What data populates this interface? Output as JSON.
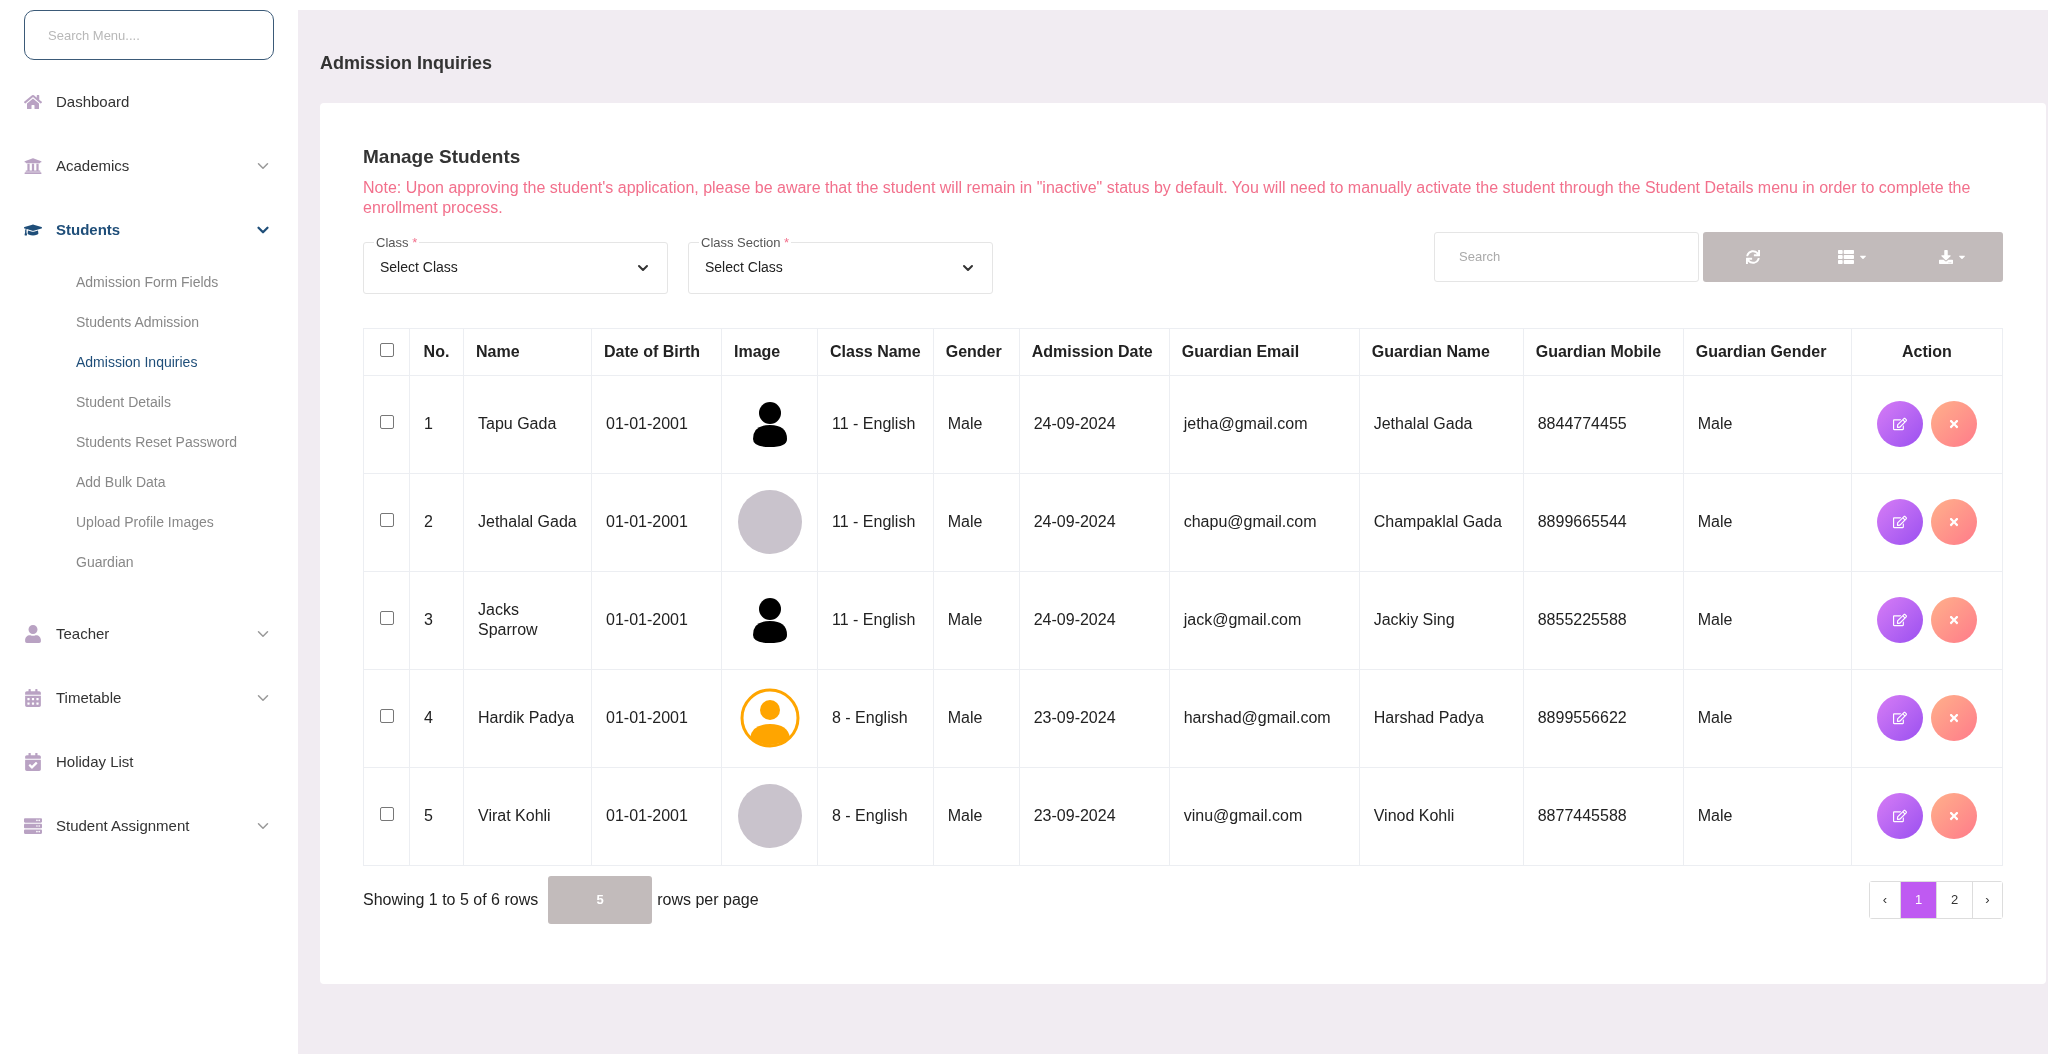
{
  "sidebar": {
    "search": {
      "placeholder": "Search Menu...."
    },
    "items": [
      {
        "label": "Dashboard",
        "selected": false
      },
      {
        "label": "Academics",
        "selected": false,
        "expanded": false
      },
      {
        "label": "Students",
        "selected": true,
        "expanded": true,
        "children": [
          {
            "label": "Admission Form Fields",
            "selected": false
          },
          {
            "label": "Students Admission",
            "selected": false
          },
          {
            "label": "Admission Inquiries",
            "selected": true
          },
          {
            "label": "Student Details",
            "selected": false
          },
          {
            "label": "Students Reset Password",
            "selected": false
          },
          {
            "label": "Add Bulk Data",
            "selected": false
          },
          {
            "label": "Upload Profile Images",
            "selected": false
          },
          {
            "label": "Guardian",
            "selected": false
          }
        ]
      },
      {
        "label": "Teacher",
        "selected": false,
        "expanded": false
      },
      {
        "label": "Timetable",
        "selected": false,
        "expanded": false
      },
      {
        "label": "Holiday List",
        "selected": false
      },
      {
        "label": "Student Assignment",
        "selected": false,
        "expanded": false
      }
    ]
  },
  "page_title": "Admission Inquiries",
  "card": {
    "title": "Manage Students",
    "note": "Note: Upon approving the student's application, please be aware that the student will remain in \"inactive\" status by default. You will need to manually activate the student through the Student Details menu in order to complete the enrollment process.",
    "filters": [
      {
        "label": "Class",
        "required_mark": "*",
        "value": "Select Class"
      },
      {
        "label": "Class Section",
        "required_mark": "*",
        "value": "Select Class"
      }
    ],
    "search": {
      "placeholder": "Search"
    },
    "table": {
      "header_checked": false,
      "columns": [
        "No.",
        "Name",
        "Date of Birth",
        "Image",
        "Class Name",
        "Gender",
        "Admission Date",
        "Guardian Email",
        "Guardian Name",
        "Guardian Mobile",
        "Guardian Gender",
        "Action"
      ],
      "rows": [
        {
          "checked": false,
          "no": "1",
          "name": "Tapu Gada",
          "dob": "01-01-2001",
          "kind": "person-icon",
          "class": "11 - English",
          "gender": "Male",
          "admission_date": "24-09-2024",
          "guardian_email": "jetha@gmail.com",
          "guardian_name": "Jethalal Gada",
          "guardian_mobile": "8844774455",
          "guardian_gender": "Male"
        },
        {
          "checked": false,
          "no": "2",
          "name": "Jethalal Gada",
          "dob": "01-01-2001",
          "kind": "photo",
          "class": "11 - English",
          "gender": "Male",
          "admission_date": "24-09-2024",
          "guardian_email": "chapu@gmail.com",
          "guardian_name": "Champaklal Gada",
          "guardian_mobile": "8899665544",
          "guardian_gender": "Male"
        },
        {
          "checked": false,
          "no": "3",
          "name": "Jacks Sparrow",
          "dob": "01-01-2001",
          "kind": "person-icon",
          "class": "11 - English",
          "gender": "Male",
          "admission_date": "24-09-2024",
          "guardian_email": "jack@gmail.com",
          "guardian_name": "Jackiy Sing",
          "guardian_mobile": "8855225588",
          "guardian_gender": "Male"
        },
        {
          "checked": false,
          "no": "4",
          "name": "Hardik Padya",
          "dob": "01-01-2001",
          "kind": "ring-icon",
          "class": "8 - English",
          "gender": "Male",
          "admission_date": "23-09-2024",
          "guardian_email": "harshad@gmail.com",
          "guardian_name": "Harshad Padya",
          "guardian_mobile": "8899556622",
          "guardian_gender": "Male"
        },
        {
          "checked": false,
          "no": "5",
          "name": "Virat Kohli",
          "dob": "01-01-2001",
          "kind": "photo",
          "class": "8 - English",
          "gender": "Male",
          "admission_date": "23-09-2024",
          "guardian_email": "vinu@gmail.com",
          "guardian_name": "Vinod Kohli",
          "guardian_mobile": "8877445588",
          "guardian_gender": "Male"
        }
      ]
    },
    "footer": {
      "showing": "Showing 1 to 5 of 6 rows",
      "page_size": "5",
      "rows_per_page": "rows per page",
      "pagination": [
        {
          "label": "‹",
          "kind": "prev",
          "selected": false
        },
        {
          "label": "1",
          "kind": "page",
          "selected": true
        },
        {
          "label": "2",
          "kind": "page",
          "selected": false
        },
        {
          "label": "›",
          "kind": "next",
          "selected": false
        }
      ]
    }
  }
}
